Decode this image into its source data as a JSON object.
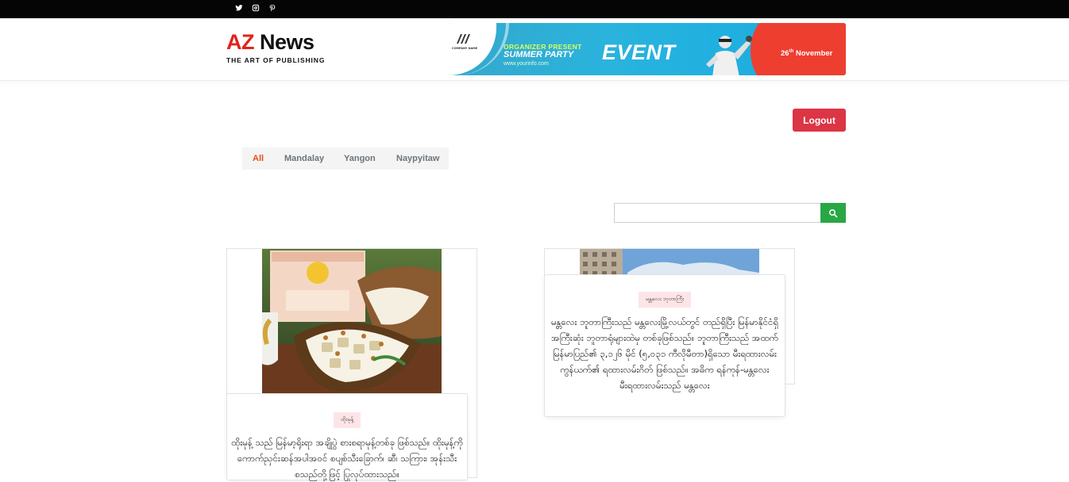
{
  "social": [
    {
      "name": "twitter-icon"
    },
    {
      "name": "instagram-icon"
    },
    {
      "name": "pinterest-icon"
    }
  ],
  "logo": {
    "brand_part1": "AZ",
    "brand_part2": " News",
    "tagline": "THE ART OF PUBLISHING"
  },
  "banner": {
    "company": "COMPANY NAME",
    "organizer": "ORGANIZER PRESENT",
    "title": "SUMMER PARTY",
    "url": "www.yourinfo.com",
    "event": "EVENT",
    "date_day": "26",
    "date_suffix": "th",
    "date_month": " November",
    "colors": {
      "primary": "#2ab3dd",
      "accent": "#ee3e30",
      "highlight": "#d8ff5a"
    }
  },
  "auth": {
    "logout_label": "Logout"
  },
  "filters": {
    "items": [
      {
        "label": "All",
        "active": true
      },
      {
        "label": "Mandalay",
        "active": false
      },
      {
        "label": "Yangon",
        "active": false
      },
      {
        "label": "Naypyitaw",
        "active": false
      }
    ]
  },
  "search": {
    "placeholder": "",
    "value": "",
    "icon": "search-icon"
  },
  "colors": {
    "logout": "#dc3545",
    "search": "#28a745",
    "active_filter": "#e84e1b",
    "tag_bg": "#fde5e7"
  },
  "posts": [
    {
      "tag": "ထိုးမုန့်",
      "excerpt": "ထိုးမုန့် သည် မြန်မာ့ရိုးရာ အချိုပွဲ စားစရာမုန့်တစ်ခု ဖြစ်သည်။ ထိုးမုန့်ကို ကောက်ညှင်းဆန်အပါအဝင် စပျစ်သီးခြောက်၊ ဆီ၊ သကြား၊ အုန်းသီး စသည်တို့ဖြင့် ပြုလုပ်ထားသည်။"
    },
    {
      "tag": "မန္တလေး ဘုတာကြီး",
      "excerpt": "မန္တလေး ဘူတာကြီးသည် မန္တလေးမြို့လယ်တွင် တည်ရှိပြီး မြန်မာနိုင်ငံရှိ အကြီးဆုံး ဘူတာရုံများထဲမှ တစ်ခုဖြစ်သည်။ ဘူတာကြီးသည် အထက်မြန်မာပြည်၏ ၃,၁၂၆ မိုင် (၅,၀၃၁ ကီလိုမီတာ)ရှိသော မီးရထားလမ်းကွန်ယက်၏ ရထားလမ်းဂိတ် ဖြစ်သည်။ အဓိက ရန်ကုန်-မန္တလေး မီးရထားလမ်းသည် မန္တလေး"
    }
  ]
}
